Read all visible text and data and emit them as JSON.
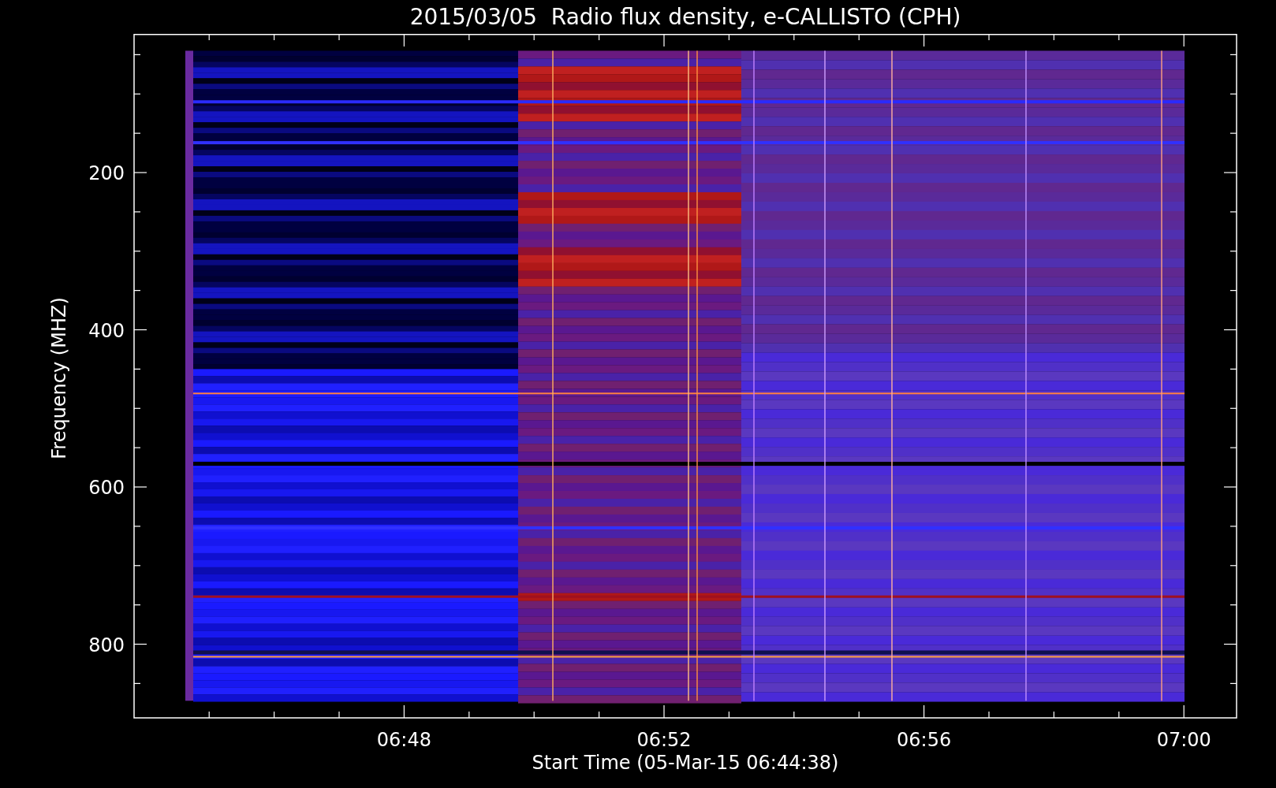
{
  "title": "2015/03/05  Radio flux density, e-CALLISTO (CPH)",
  "chart": {
    "ylabel": "Frequency (MHZ)",
    "xlabel": "Start Time (05-Mar-15 06:44:38)",
    "yticks": [
      "200",
      "400",
      "600",
      "800"
    ],
    "xticks": [
      "06:48",
      "06:52",
      "06:56",
      "07:00"
    ]
  }
}
